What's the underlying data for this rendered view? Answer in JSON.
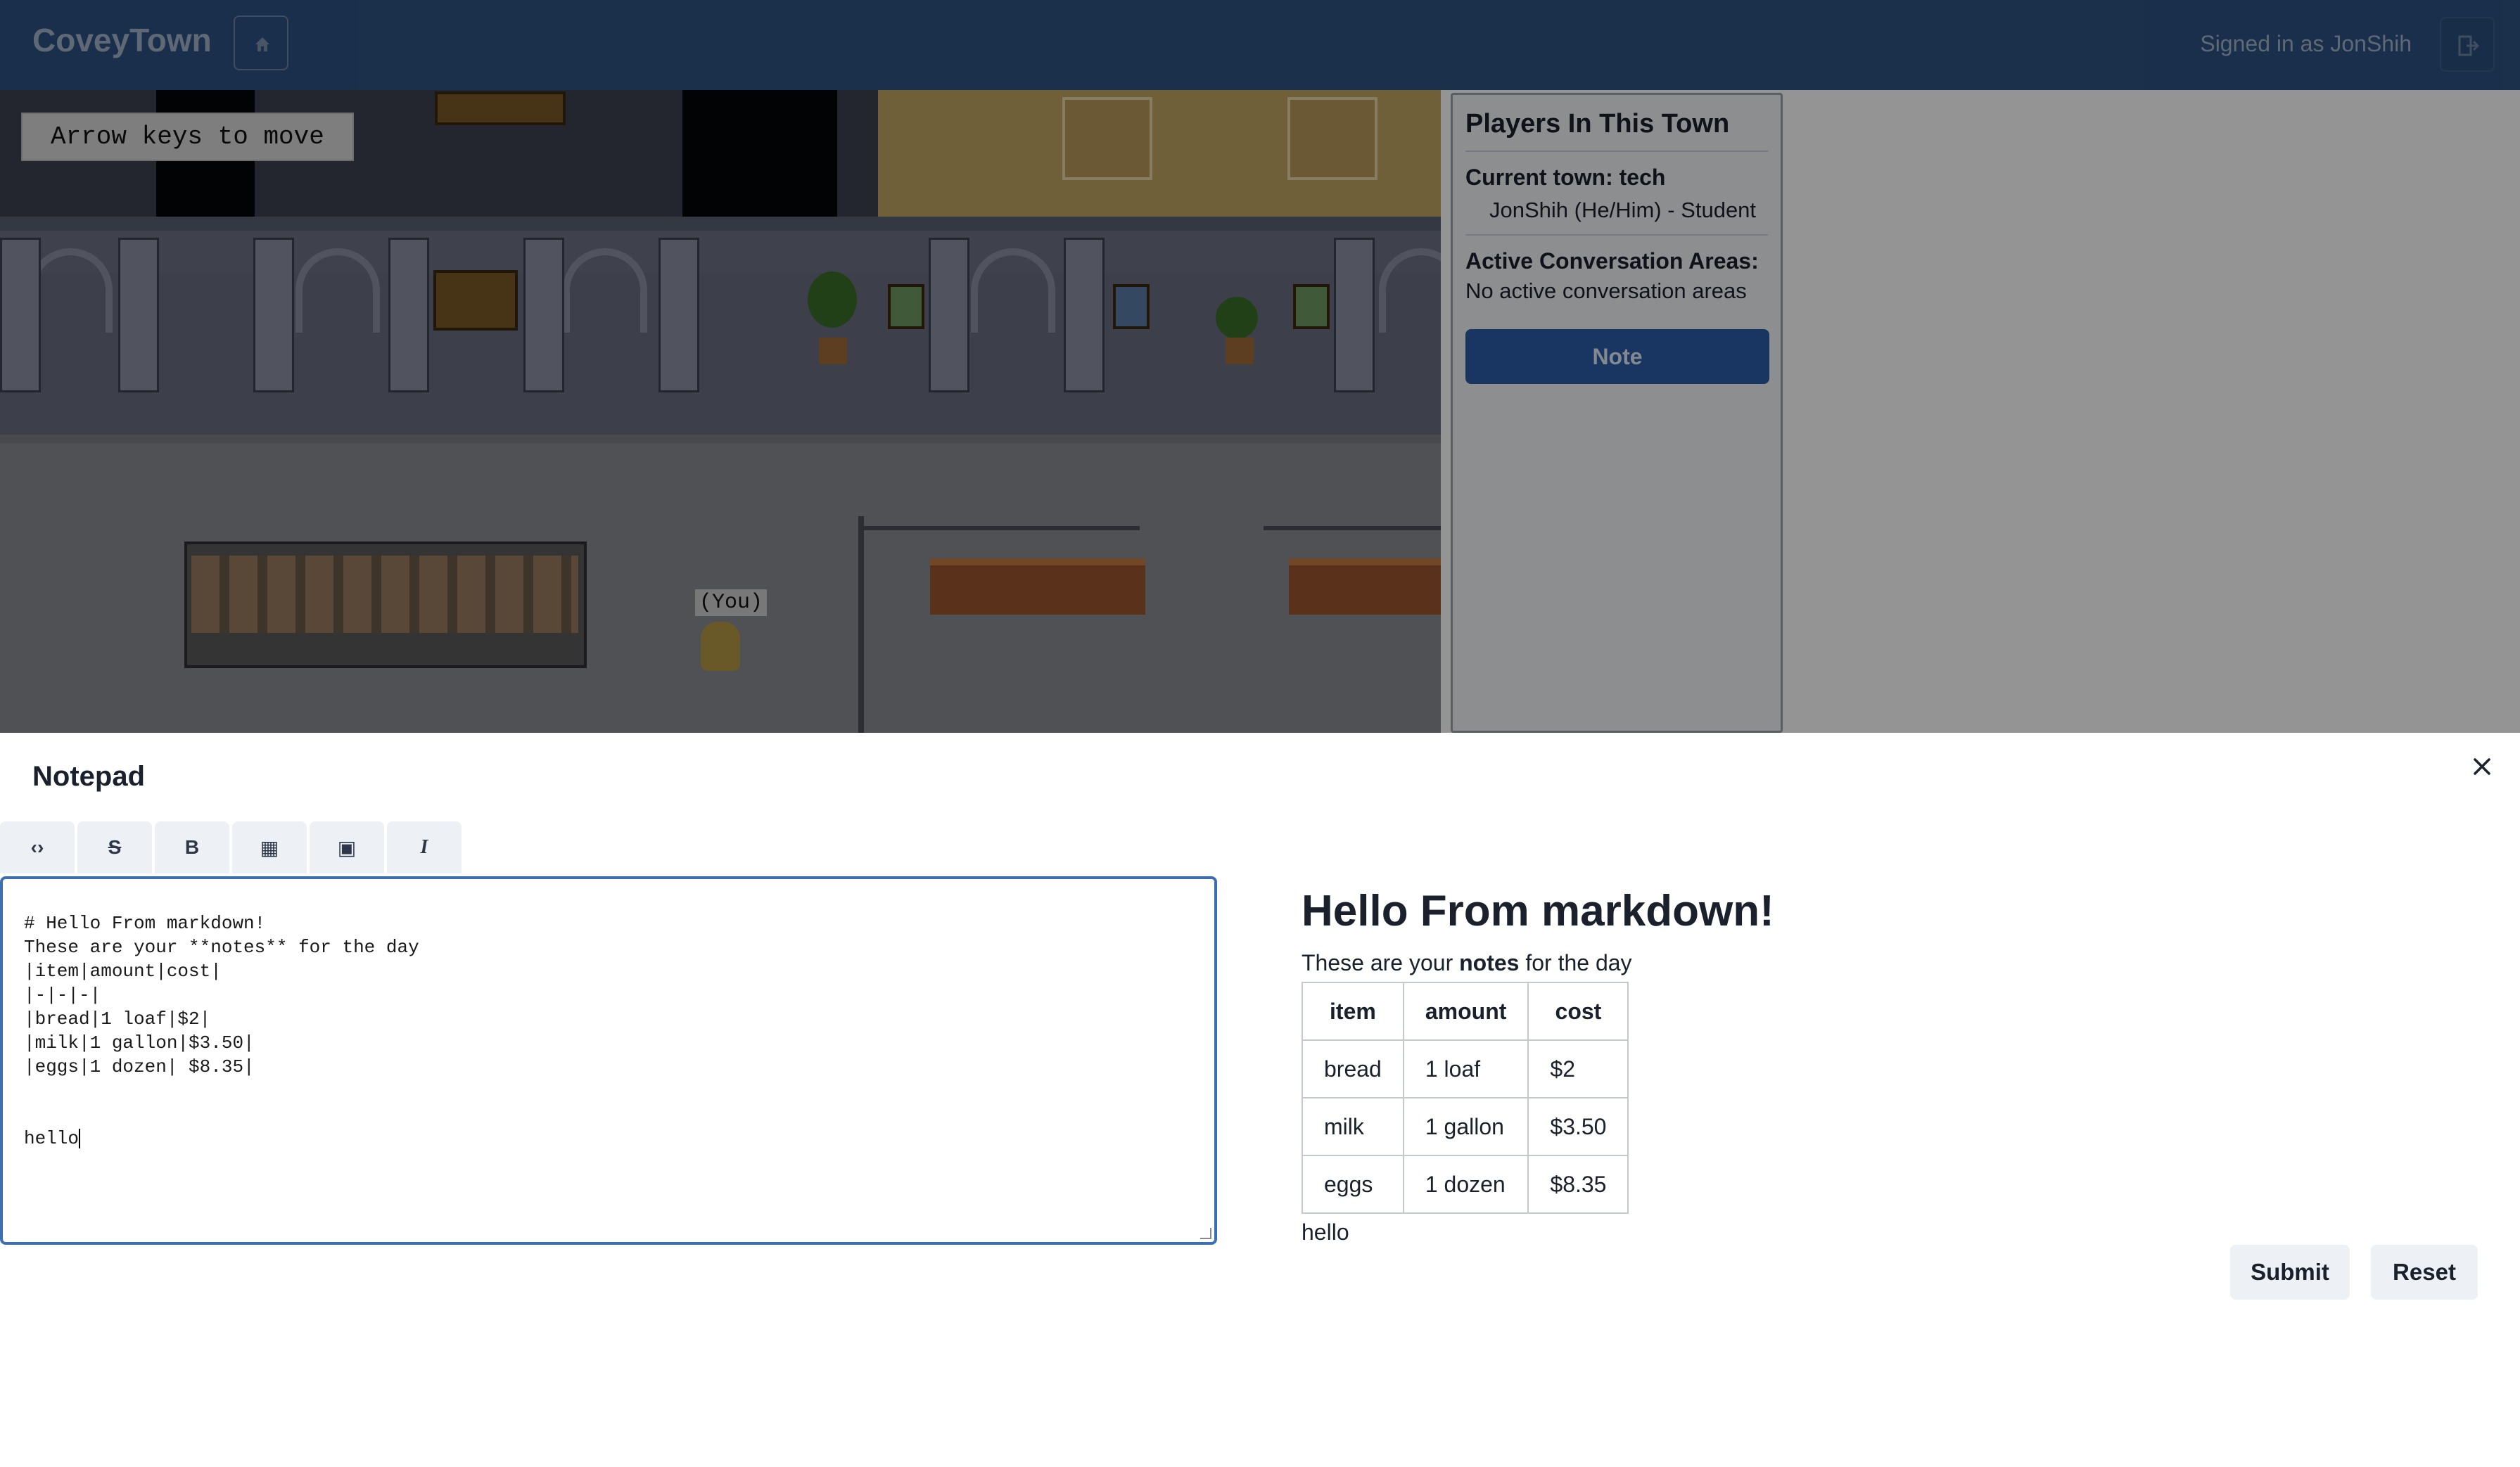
{
  "header": {
    "brand": "CoveyTown",
    "signed_in": "Signed in as JonShih",
    "home_icon": "home-icon",
    "logout_icon": "logout-icon"
  },
  "game": {
    "hint": "Arrow keys to move",
    "avatar_label": "(You)"
  },
  "players_panel": {
    "title": "Players In This Town",
    "current_town_label": "Current town: tech",
    "players": [
      "JonShih (He/Him) - Student"
    ],
    "areas_label": "Active Conversation Areas:",
    "areas_text": "No active conversation areas",
    "note_button": "Note"
  },
  "notepad": {
    "title": "Notepad",
    "close_icon": "close-icon",
    "toolbar": [
      {
        "name": "code-icon",
        "glyph": "‹›"
      },
      {
        "name": "strikethrough-icon",
        "glyph": "S"
      },
      {
        "name": "bold-icon",
        "glyph": "B"
      },
      {
        "name": "table-icon",
        "glyph": "▦"
      },
      {
        "name": "image-icon",
        "glyph": "▣"
      },
      {
        "name": "italic-icon",
        "glyph": "I"
      }
    ],
    "editor_lines": [
      "# Hello From markdown!",
      "These are your **notes** for the day",
      "|item|amount|cost|",
      "|-|-|-|",
      "|bread|1 loaf|$2|",
      "|milk|1 gallon|$3.50|",
      "|eggs|1 dozen| $8.35|",
      "",
      "",
      "hello"
    ],
    "preview": {
      "heading": "Hello From markdown!",
      "para_before": "These are your ",
      "para_bold": "notes",
      "para_after": " for the day",
      "table_headers": [
        "item",
        "amount",
        "cost"
      ],
      "table_rows": [
        [
          "bread",
          "1 loaf",
          "$2"
        ],
        [
          "milk",
          "1 gallon",
          "$3.50"
        ],
        [
          "eggs",
          "1 dozen",
          "$8.35"
        ]
      ],
      "after_text": "hello"
    },
    "submit_label": "Submit",
    "reset_label": "Reset"
  },
  "colors": {
    "nav_bg": "#2c5282",
    "note_button": "#2c5eab",
    "editor_border": "#3c6fb0"
  }
}
